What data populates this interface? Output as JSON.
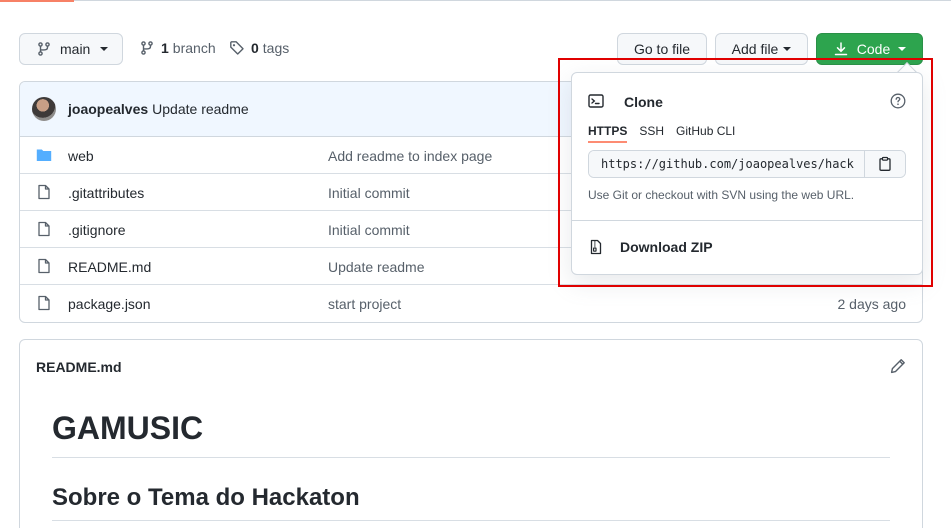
{
  "branch": {
    "name": "main"
  },
  "meta": {
    "branch_count": "1",
    "branch_label": "branch",
    "tag_count": "0",
    "tag_label": "tags"
  },
  "buttons": {
    "goto_file": "Go to file",
    "add_file": "Add file",
    "code": "Code"
  },
  "commit": {
    "author": "joaopealves",
    "message": "Update readme"
  },
  "files": [
    {
      "name": "web",
      "type": "folder",
      "commit": "Add readme to index page",
      "age": ""
    },
    {
      "name": ".gitattributes",
      "type": "file",
      "commit": "Initial commit",
      "age": ""
    },
    {
      "name": ".gitignore",
      "type": "file",
      "commit": "Initial commit",
      "age": ""
    },
    {
      "name": "README.md",
      "type": "file",
      "commit": "Update readme",
      "age": ""
    },
    {
      "name": "package.json",
      "type": "file",
      "commit": "start project",
      "age": "2 days ago"
    }
  ],
  "readme": {
    "title": "README.md",
    "h1": "GAMUSIC",
    "h2": "Sobre o Tema do Hackaton"
  },
  "clone": {
    "title": "Clone",
    "tabs": [
      "HTTPS",
      "SSH",
      "GitHub CLI"
    ],
    "active_tab": "HTTPS",
    "url": "https://github.com/joaopealves/hack",
    "help": "Use Git or checkout with SVN using the web URL.",
    "download_zip": "Download ZIP"
  },
  "colors": {
    "accent_green": "#2da44e",
    "folder_blue": "#54aeff",
    "highlight_red": "#e00000",
    "tab_underline": "#fd8c73"
  }
}
